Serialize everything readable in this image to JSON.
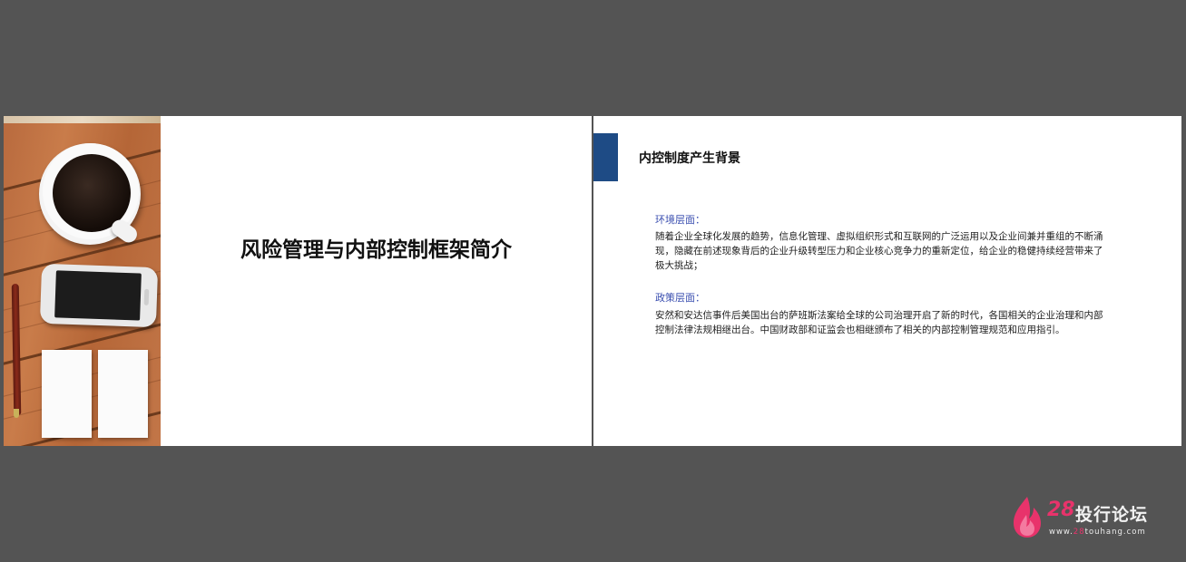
{
  "left_slide": {
    "title": "风险管理与内部控制框架简介"
  },
  "right_slide": {
    "heading": "内控制度产生背景",
    "sections": [
      {
        "label": "环境层面：",
        "text": "随着企业全球化发展的趋势，信息化管理、虚拟组织形式和互联网的广泛运用以及企业间兼并重组的不断涌现，隐藏在前述现象背后的企业升级转型压力和企业核心竞争力的重新定位，给企业的稳健持续经营带来了极大挑战；"
      },
      {
        "label": "政策层面：",
        "text": "安然和安达信事件后美国出台的萨班斯法案给全球的公司治理开启了新的时代，各国相关的企业治理和内部控制法律法规相继出台。中国财政部和证监会也相继颁布了相关的内部控制管理规范和应用指引。"
      }
    ]
  },
  "watermark": {
    "number": "28",
    "title": "投行论坛",
    "url_prefix": "www.",
    "url_mid": "28",
    "url_suffix": "touhang.com"
  },
  "colors": {
    "background": "#545454",
    "accent_bar": "#1e4b85",
    "section_label": "#3b4fb0",
    "watermark_red": "#e8336b"
  },
  "icons": {
    "watermark_logo": "flame-logo-icon"
  }
}
